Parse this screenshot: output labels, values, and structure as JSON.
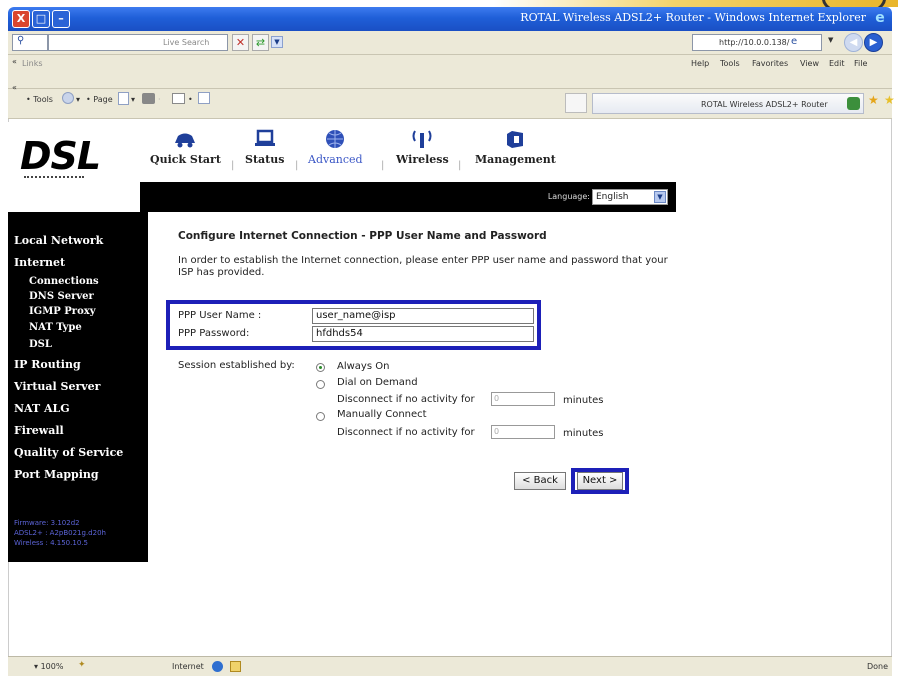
{
  "window": {
    "title": "ROTAL Wireless ADSL2+ Router - Windows Internet Explorer",
    "close_symbol": "X"
  },
  "search_bar": {
    "placeholder": "Live Search",
    "url": "http://10.0.0.138/"
  },
  "links_bar": {
    "links_label": "Links",
    "menu": [
      "Help",
      "Tools",
      "Favorites",
      "View",
      "Edit",
      "File"
    ]
  },
  "command_bar": {
    "tools_label": "Tools",
    "page_label": "Page",
    "tab_title": "ROTAL Wireless ADSL2+ Router"
  },
  "router": {
    "logo": "DSL",
    "nav": [
      {
        "label": "Quick Start",
        "icon": "car-icon"
      },
      {
        "label": "Status",
        "icon": "laptop-icon"
      },
      {
        "label": "Advanced",
        "icon": "globe-icon"
      },
      {
        "label": "Wireless",
        "icon": "antenna-icon"
      },
      {
        "label": "Management",
        "icon": "router-icon"
      }
    ],
    "language_label": "Language:",
    "language_value": "English",
    "sidebar": {
      "items": [
        {
          "label": "Local Network",
          "sub": false
        },
        {
          "label": "Internet",
          "sub": false
        },
        {
          "label": "Connections",
          "sub": true
        },
        {
          "label": "DNS Server",
          "sub": true
        },
        {
          "label": "IGMP Proxy",
          "sub": true
        },
        {
          "label": "NAT Type",
          "sub": true
        },
        {
          "label": "DSL",
          "sub": true
        },
        {
          "label": "IP Routing",
          "sub": false
        },
        {
          "label": "Virtual Server",
          "sub": false
        },
        {
          "label": "NAT ALG",
          "sub": false
        },
        {
          "label": "Firewall",
          "sub": false
        },
        {
          "label": "Quality of Service",
          "sub": false
        },
        {
          "label": "Port Mapping",
          "sub": false
        }
      ],
      "firmware": "Firmware: 3.102d2",
      "adsl": "ADSL2+ : A2pB021g.d20h",
      "wireless": "Wireless : 4.150.10.5"
    },
    "form": {
      "title": "Configure Internet Connection - PPP User Name and Password",
      "description": "In order to establish the Internet connection, please enter PPP user name and password that your ISP has provided.",
      "username_label": "PPP User Name :",
      "username_value": "user_name@isp",
      "password_label": "PPP Password:",
      "password_value": "hfdhds54",
      "session_label": "Session established by:",
      "options": {
        "always_on": "Always On",
        "dial_on_demand": "Dial on Demand",
        "manually_connect": "Manually Connect"
      },
      "disconnect_label": "Disconnect if no activity for",
      "disconnect_value_1": "0",
      "disconnect_value_2": "0",
      "minutes": "minutes",
      "back_button": "< Back",
      "next_button": "Next >"
    }
  },
  "status_bar": {
    "zoom": "100%",
    "zone": "Internet",
    "status": "Done"
  }
}
